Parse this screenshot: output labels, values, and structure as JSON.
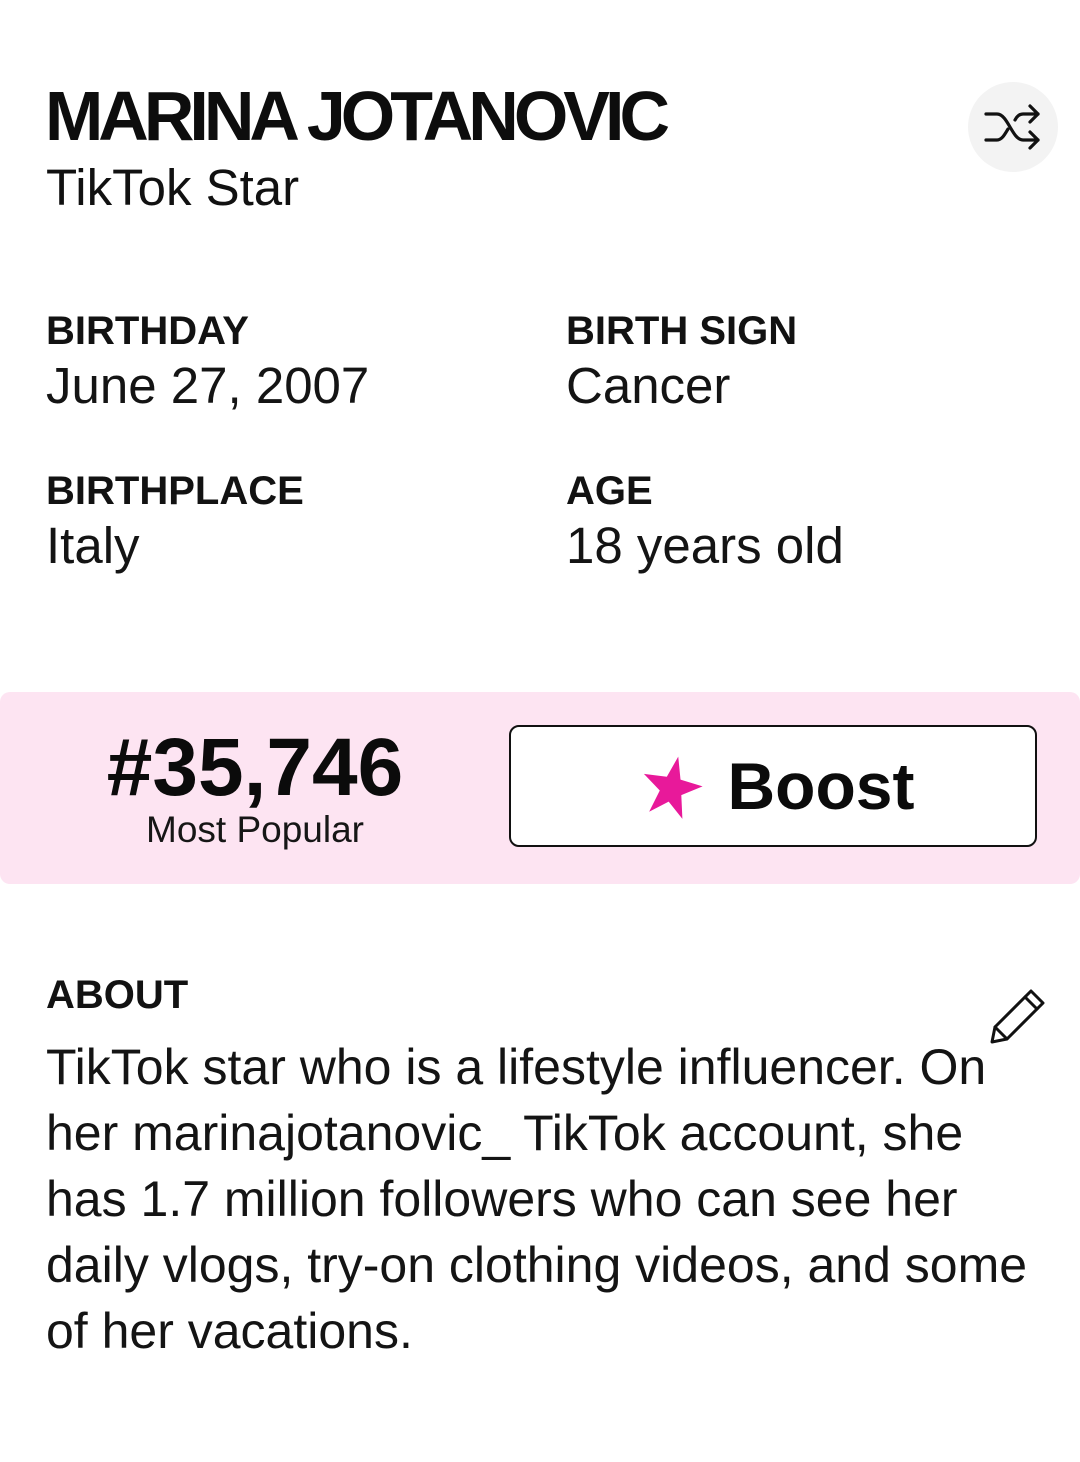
{
  "profile": {
    "name": "MARINA JOTANOVIC",
    "profession": "TikTok Star"
  },
  "facts": {
    "birthday": {
      "label": "BIRTHDAY",
      "value": "June 27, 2007"
    },
    "birth_sign": {
      "label": "BIRTH SIGN",
      "value": "Cancer"
    },
    "birthplace": {
      "label": "BIRTHPLACE",
      "value": "Italy"
    },
    "age": {
      "label": "AGE",
      "value": "18 years old"
    }
  },
  "popularity": {
    "rank": "#35,746",
    "caption": "Most Popular",
    "boost_label": "Boost",
    "star_color": "#e8199a"
  },
  "about": {
    "label": "ABOUT",
    "text": "TikTok star who is a lifestyle influencer. On her marinajotanovic_ TikTok account, she has 1.7 million followers who can see her daily vlogs, try-on clothing videos, and some of her vacations."
  },
  "icons": {
    "shuffle": "shuffle-icon",
    "edit": "pencil-icon",
    "boost": "star-icon"
  },
  "colors": {
    "rank_band_background": "#fde4f2",
    "shuffle_button_background": "#f3f3f3",
    "accent": "#e8199a"
  }
}
